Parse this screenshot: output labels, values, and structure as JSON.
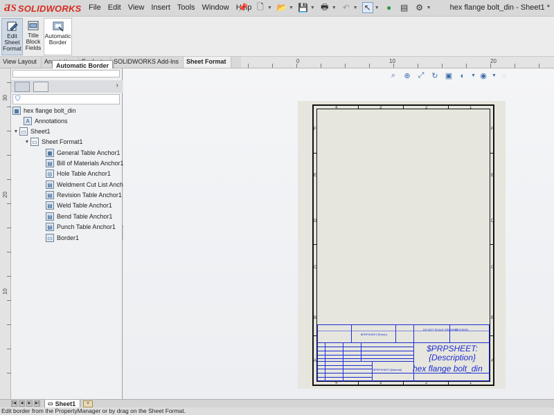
{
  "app": {
    "logo": "SOLIDWORKS",
    "document_title": "hex flange bolt_din - Sheet1 *"
  },
  "menu": [
    "File",
    "Edit",
    "View",
    "Insert",
    "Tools",
    "Window",
    "Help"
  ],
  "quick_toolbar": {
    "icons": [
      "new-document-icon",
      "open-icon",
      "save-icon",
      "print-icon",
      "undo-icon",
      "select-icon",
      "rebuild-icon",
      "file-properties-icon",
      "options-icon"
    ]
  },
  "ribbon": {
    "buttons": [
      {
        "label": "Edit Sheet Format",
        "icon": "edit-sheet-format-icon",
        "active": true
      },
      {
        "label": "Title Block Fields",
        "icon": "title-block-fields-icon",
        "active": false
      },
      {
        "label": "Automatic Border",
        "icon": "automatic-border-icon",
        "active": false
      }
    ]
  },
  "tabs": [
    "View Layout",
    "Annotation",
    "Evaluate",
    "SOLIDWORKS Add-Ins",
    "Sheet Format"
  ],
  "selected_tab": "Sheet Format",
  "tooltip": "Automatic Border",
  "hruler_labels": [
    "0",
    "10",
    "20"
  ],
  "vruler_labels": [
    "30",
    "20",
    "10"
  ],
  "tree": {
    "root": "hex flange bolt_din",
    "items": [
      {
        "label": "Annotations",
        "icon": "annotations-icon",
        "level": 1,
        "expander": ""
      },
      {
        "label": "Sheet1",
        "icon": "sheet-icon",
        "level": 1,
        "expander": "▼"
      },
      {
        "label": "Sheet Format1",
        "icon": "sheet-format-icon",
        "level": 2,
        "expander": "▼"
      },
      {
        "label": "General Table Anchor1",
        "icon": "general-table-anchor-icon",
        "level": 3,
        "expander": ""
      },
      {
        "label": "Bill of Materials Anchor1",
        "icon": "bom-anchor-icon",
        "level": 3,
        "expander": ""
      },
      {
        "label": "Hole Table Anchor1",
        "icon": "hole-table-anchor-icon",
        "level": 3,
        "expander": ""
      },
      {
        "label": "Weldment Cut List Anchor1",
        "icon": "weldment-anchor-icon",
        "level": 3,
        "expander": ""
      },
      {
        "label": "Revision Table Anchor1",
        "icon": "revision-anchor-icon",
        "level": 3,
        "expander": ""
      },
      {
        "label": "Weld Table Anchor1",
        "icon": "weld-table-anchor-icon",
        "level": 3,
        "expander": ""
      },
      {
        "label": "Bend Table Anchor1",
        "icon": "bend-table-anchor-icon",
        "level": 3,
        "expander": ""
      },
      {
        "label": "Punch Table Anchor1",
        "icon": "punch-table-anchor-icon",
        "level": 3,
        "expander": ""
      },
      {
        "label": "Border1",
        "icon": "border-icon",
        "level": 3,
        "expander": ""
      }
    ]
  },
  "sheet": {
    "zone_numbers": [
      "4",
      "3",
      "2",
      "1"
    ],
    "zone_letters": [
      "F",
      "E",
      "D",
      "C",
      "B",
      "A"
    ],
    "title_block": {
      "description": "$PRPSHEET:{Description}",
      "part_name": "hex flange bolt_din",
      "small_fields": [
        "$PRPSHEET:{Finish}",
        "$PRPSHEET:{Material}",
        "DO NOT SCALE DRAWING",
        "REVISION"
      ]
    }
  },
  "sheet_tab": "Sheet1",
  "status": "Edit border from the PropertyManager or by drag on the Sheet Format."
}
